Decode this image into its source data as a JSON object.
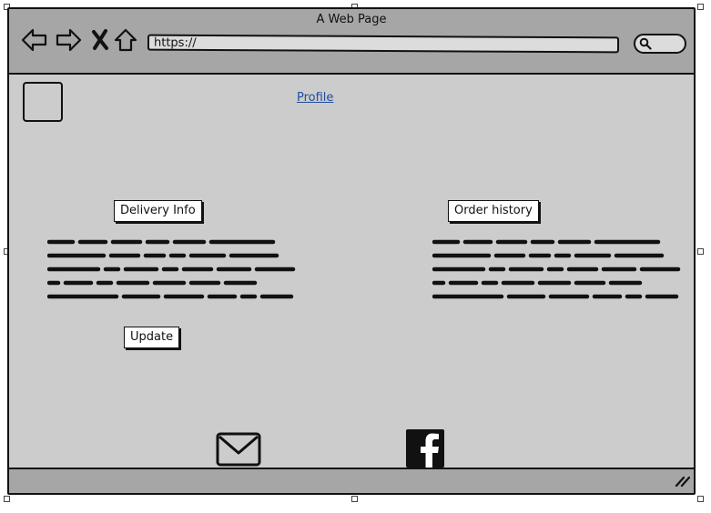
{
  "window": {
    "title": "A Web Page",
    "url": "https://"
  },
  "content": {
    "profile_link": "Profile",
    "delivery_info_button": "Delivery Info",
    "order_history_button": "Order history",
    "update_button": "Update"
  },
  "footer": {
    "icons": [
      "mail-icon",
      "facebook-icon"
    ]
  }
}
